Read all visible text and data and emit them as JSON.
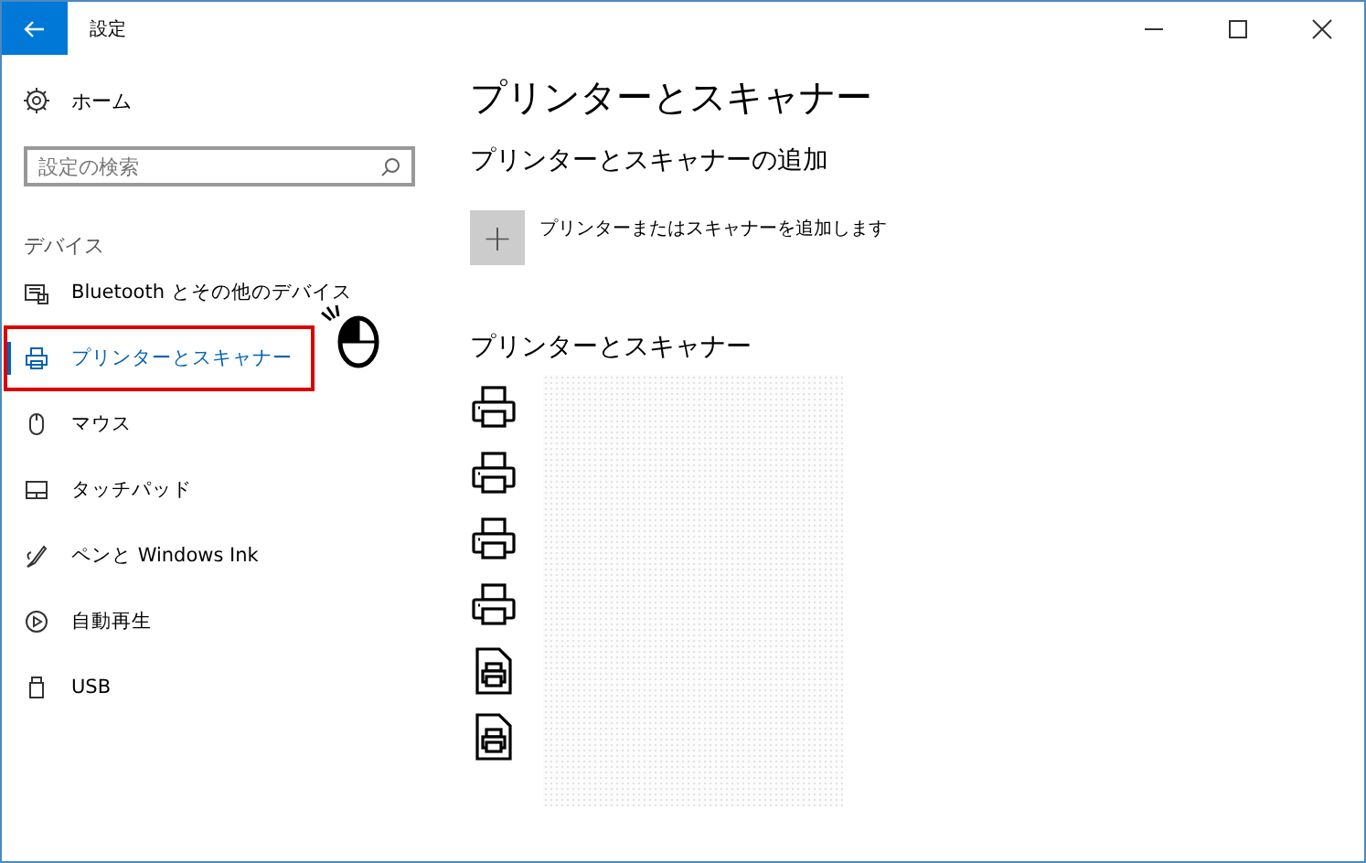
{
  "window": {
    "title": "設定"
  },
  "sidebar": {
    "home": "ホーム",
    "search": {
      "placeholder": "設定の検索"
    },
    "section": "デバイス",
    "items": [
      {
        "label": "Bluetooth とその他のデバイス",
        "kind": "bluetooth",
        "selected": false,
        "annotated": false
      },
      {
        "label": "プリンターとスキャナー",
        "kind": "printer",
        "selected": true,
        "annotated": true
      },
      {
        "label": "マウス",
        "kind": "mouse",
        "selected": false,
        "annotated": false
      },
      {
        "label": "タッチパッド",
        "kind": "touchpad",
        "selected": false,
        "annotated": false
      },
      {
        "label": "ペンと Windows Ink",
        "kind": "pen",
        "selected": false,
        "annotated": false
      },
      {
        "label": "自動再生",
        "kind": "autoplay",
        "selected": false,
        "annotated": false
      },
      {
        "label": "USB",
        "kind": "usb",
        "selected": false,
        "annotated": false
      }
    ]
  },
  "main": {
    "title": "プリンターとスキャナー",
    "add_heading": "プリンターとスキャナーの追加",
    "add_button": "+",
    "add_label": "プリンターまたはスキャナーを追加します",
    "list_heading": "プリンターとスキャナー",
    "devices": [
      {
        "kind": "printer"
      },
      {
        "kind": "printer"
      },
      {
        "kind": "printer"
      },
      {
        "kind": "printer"
      },
      {
        "kind": "document"
      },
      {
        "kind": "document"
      }
    ]
  }
}
